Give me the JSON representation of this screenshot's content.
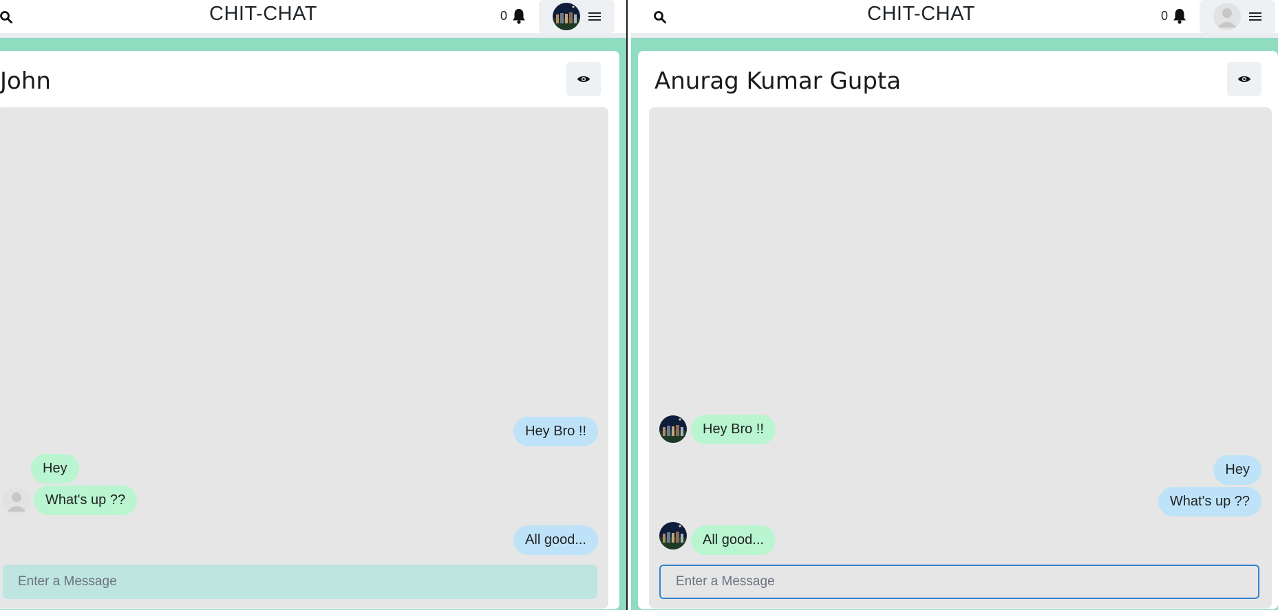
{
  "app": {
    "title": "CHIT-CHAT"
  },
  "colors": {
    "accent": "#8fdcc1",
    "sent_bubble": "#bee3f8",
    "received_bubble": "#b9f5d0",
    "focus_border": "#3182ce"
  },
  "left": {
    "notification_count": "0",
    "chat_title": "John",
    "messages": [
      {
        "text": "Hey Bro !!",
        "direction": "sent"
      },
      {
        "text": "Hey",
        "direction": "received"
      },
      {
        "text": "What's up ??",
        "direction": "received"
      },
      {
        "text": "All good...",
        "direction": "sent"
      }
    ],
    "input_placeholder": "Enter a Message"
  },
  "right": {
    "notification_count": "0",
    "chat_title": "Anurag Kumar Gupta",
    "messages": [
      {
        "text": "Hey Bro !!",
        "direction": "received"
      },
      {
        "text": "Hey",
        "direction": "sent"
      },
      {
        "text": "What's up ??",
        "direction": "sent"
      },
      {
        "text": "All good...",
        "direction": "received"
      }
    ],
    "input_placeholder": "Enter a Message"
  },
  "icons": {
    "search": "search-icon",
    "notification": "bell-icon",
    "menu": "hamburger-icon",
    "view_profile": "eye-icon",
    "user_photo": "user-photo-avatar",
    "default_user": "default-user-avatar"
  }
}
